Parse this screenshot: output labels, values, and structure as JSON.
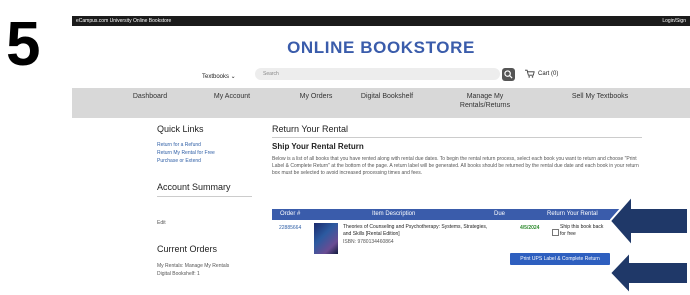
{
  "step_number": "5",
  "topbar": {
    "site_name": "eCampus.com University Online Bookstore",
    "login": "Login/Sign"
  },
  "header": {
    "logo": "ONLINE BOOKSTORE",
    "textbooks_label": "Textbooks ⌄",
    "search_placeholder": "Search",
    "cart_label": "Cart (0)"
  },
  "nav": {
    "items": [
      {
        "label": "Dashboard"
      },
      {
        "label": "My Account"
      },
      {
        "label": "My Orders"
      },
      {
        "label": "Digital Bookshelf"
      },
      {
        "label": "Manage My Rentals/Returns"
      },
      {
        "label": "Sell My Textbooks"
      }
    ]
  },
  "sidebar": {
    "quick_links_title": "Quick Links",
    "links": [
      "Return for a Refund",
      "Return My Rental for Free",
      "Purchase or Extend"
    ],
    "account_summary_title": "Account Summary",
    "edit_label": "Edit",
    "current_orders_title": "Current Orders",
    "orders_text": [
      "My Rentals: Manage My Rentals",
      "Digital Bookshelf: 1"
    ]
  },
  "main": {
    "title": "Return Your Rental",
    "subtitle": "Ship Your Rental Return",
    "description": "Below is a list of all books that you have rented along with rental due dates. To begin the rental return process, select each book you want to return and choose \"Print Label & Complete Return\" at the bottom of the page. A return label will be generated. All books should be returned by the rental due date and each book in your return box must be selected to avoid increased processing times and fees.",
    "table": {
      "headers": [
        "Order #",
        "Item Description",
        "Due",
        "Return Your Rental"
      ],
      "rows": [
        {
          "order": "22885664",
          "title": "Theories of Counseling and Psychotherapy: Systems, Strategies, and Skills [Rental Edition]",
          "isbn": "ISBN: 9780134460864",
          "due": "4/5/2024",
          "return_label": "Ship this book back for free"
        }
      ]
    },
    "print_button": "Print UPS Label & Complete Return"
  },
  "colors": {
    "brand": "#3a5cab",
    "arrow": "#1f3868",
    "due": "#2e8b2e"
  }
}
